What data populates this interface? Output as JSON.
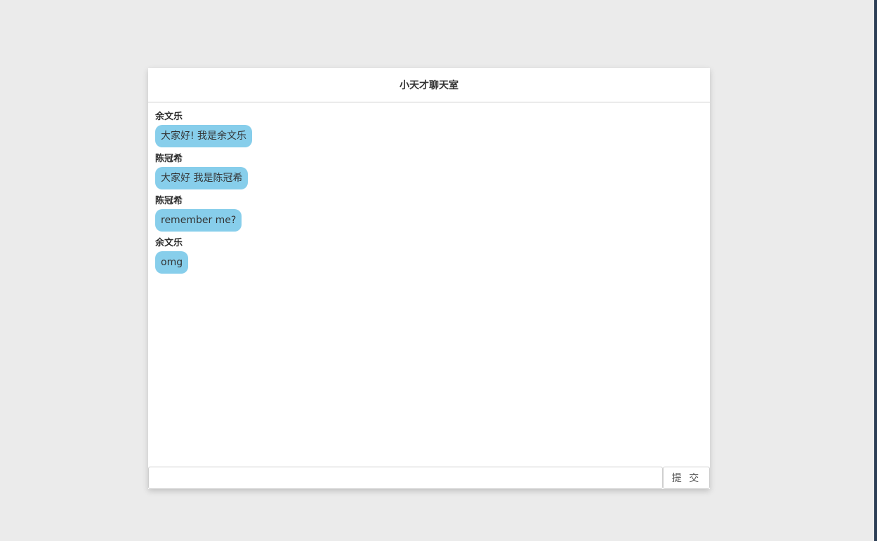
{
  "chat": {
    "title": "小天才聊天室",
    "messages": [
      {
        "sender": "余文乐",
        "text": "大家好! 我是余文乐"
      },
      {
        "sender": "陈冠希",
        "text": "大家好 我是陈冠希"
      },
      {
        "sender": "陈冠希",
        "text": "remember me?"
      },
      {
        "sender": "余文乐",
        "text": "omg"
      }
    ]
  },
  "composer": {
    "input_value": "",
    "submit_label": "提 交"
  },
  "colors": {
    "page_background": "#ebebeb",
    "bubble": "#87ceeb",
    "window": "#ffffff"
  }
}
